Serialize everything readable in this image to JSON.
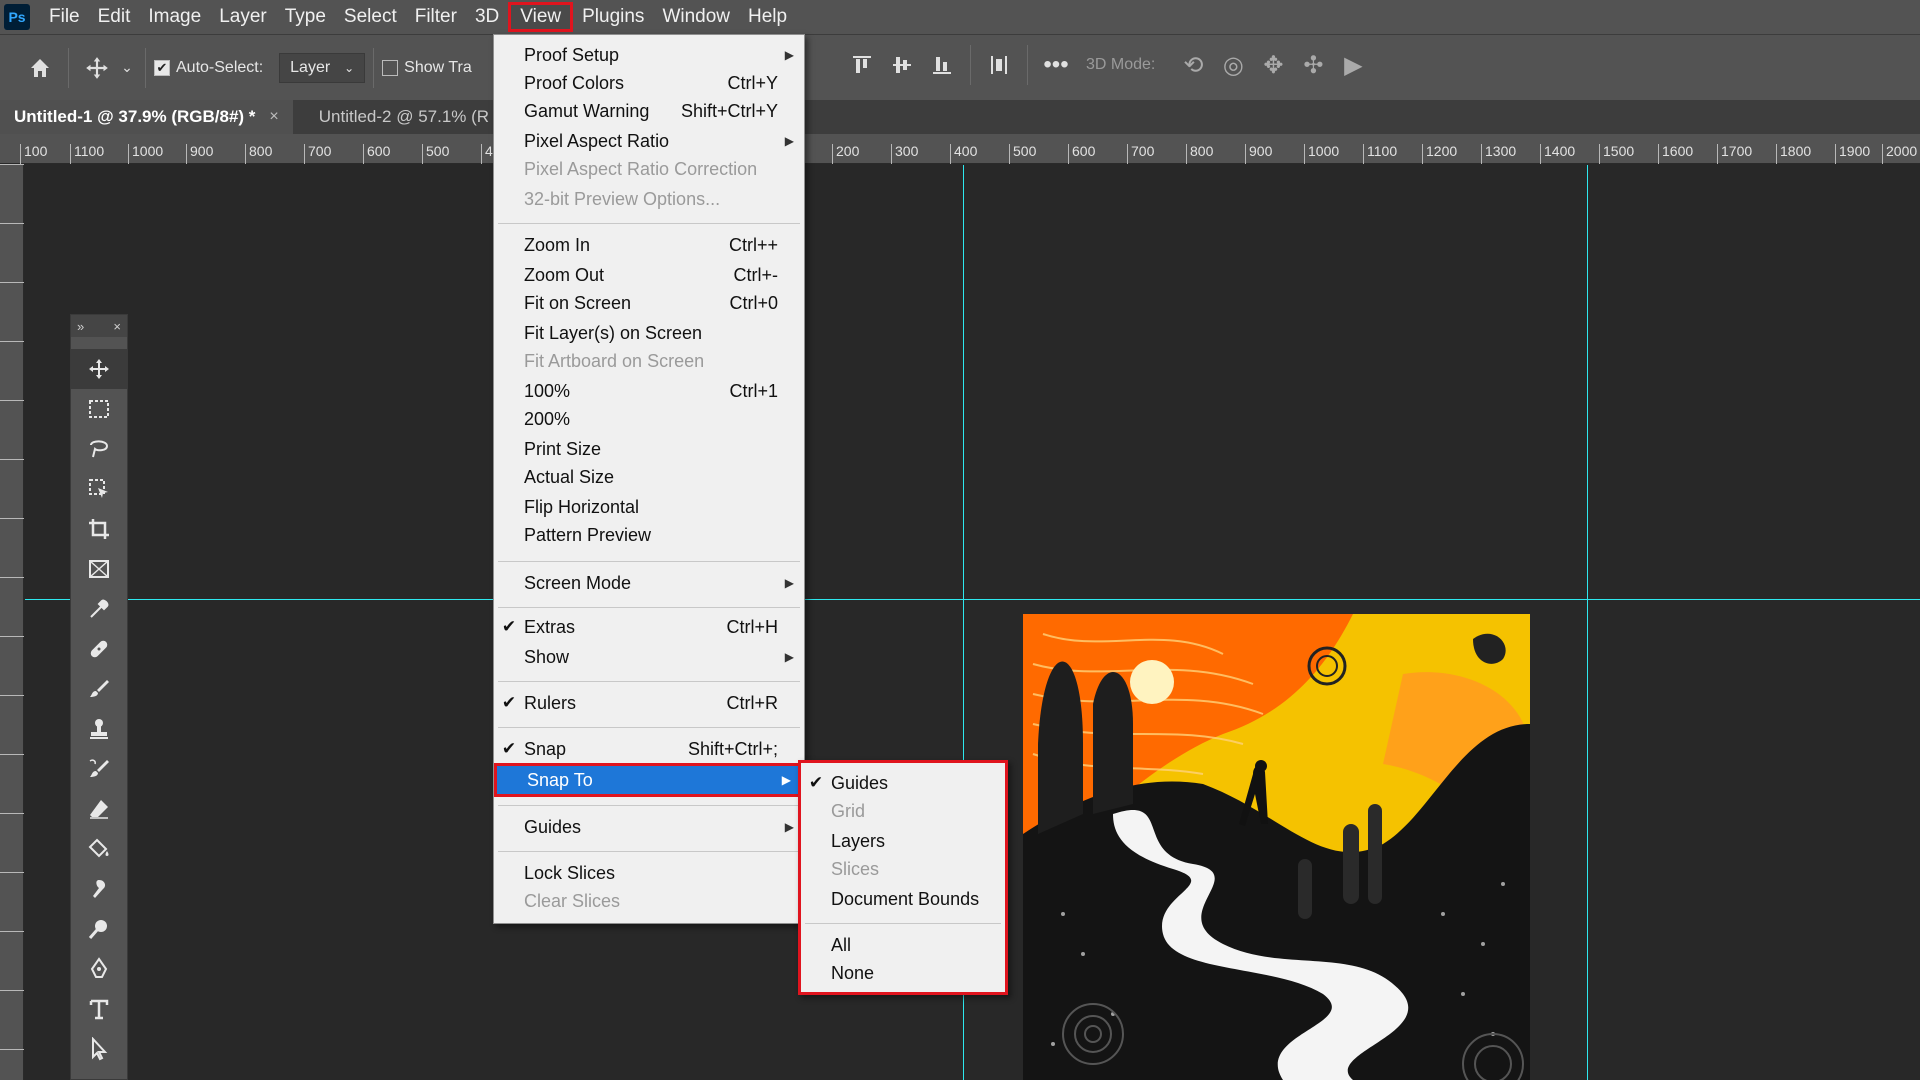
{
  "app": {
    "logo": "Ps",
    "menu": [
      "File",
      "Edit",
      "Image",
      "Layer",
      "Type",
      "Select",
      "Filter",
      "3D",
      "View",
      "Plugins",
      "Window",
      "Help"
    ],
    "active_menu": "View"
  },
  "options": {
    "auto_select_label": "Auto-Select:",
    "layer_select": "Layer",
    "show_transform_label": "Show Tra",
    "mode_3d_label": "3D Mode:"
  },
  "tabs": [
    {
      "label": "Untitled-1 @ 37.9% (RGB/8#) *",
      "close": "×"
    },
    {
      "label": "Untitled-2 @ 57.1% (R"
    }
  ],
  "ruler_labels": [
    "100",
    "1100",
    "1000",
    "900",
    "800",
    "700",
    "600",
    "500",
    "4",
    "200",
    "300",
    "400",
    "500",
    "600",
    "700",
    "800",
    "900",
    "1000",
    "1100",
    "1200",
    "1300",
    "1400",
    "1500",
    "1600",
    "1700",
    "1800",
    "1900",
    "2000"
  ],
  "toolbox": {
    "expand": "»",
    "close": "×"
  },
  "view_menu": {
    "items": [
      {
        "label": "Proof Setup",
        "submenu": true
      },
      {
        "label": "Proof Colors",
        "shortcut": "Ctrl+Y"
      },
      {
        "label": "Gamut Warning",
        "shortcut": "Shift+Ctrl+Y"
      },
      {
        "label": "Pixel Aspect Ratio",
        "submenu": true
      },
      {
        "label": "Pixel Aspect Ratio Correction",
        "disabled": true
      },
      {
        "label": "32-bit Preview Options...",
        "disabled": true
      },
      {
        "label": "Zoom In",
        "shortcut": "Ctrl++"
      },
      {
        "label": "Zoom Out",
        "shortcut": "Ctrl+-"
      },
      {
        "label": "Fit on Screen",
        "shortcut": "Ctrl+0"
      },
      {
        "label": "Fit Layer(s) on Screen"
      },
      {
        "label": "Fit Artboard on Screen",
        "disabled": true
      },
      {
        "label": "100%",
        "shortcut": "Ctrl+1"
      },
      {
        "label": "200%"
      },
      {
        "label": "Print Size"
      },
      {
        "label": "Actual Size"
      },
      {
        "label": "Flip Horizontal"
      },
      {
        "label": "Pattern Preview"
      },
      {
        "label": "Screen Mode",
        "submenu": true
      },
      {
        "label": "Extras",
        "shortcut": "Ctrl+H",
        "checked": true
      },
      {
        "label": "Show",
        "submenu": true
      },
      {
        "label": "Rulers",
        "shortcut": "Ctrl+R",
        "checked": true
      },
      {
        "label": "Snap",
        "shortcut": "Shift+Ctrl+;",
        "checked": true
      },
      {
        "label": "Snap To",
        "submenu": true,
        "highlighted": true
      },
      {
        "label": "Guides",
        "submenu": true
      },
      {
        "label": "Lock Slices"
      },
      {
        "label": "Clear Slices",
        "disabled": true
      }
    ]
  },
  "snap_to_menu": {
    "items": [
      {
        "label": "Guides",
        "checked": true
      },
      {
        "label": "Grid",
        "disabled": true
      },
      {
        "label": "Layers"
      },
      {
        "label": "Slices",
        "disabled": true
      },
      {
        "label": "Document Bounds"
      },
      {
        "label": "All"
      },
      {
        "label": "None"
      }
    ]
  },
  "colors": {
    "accent_highlight": "#1e77d8",
    "annotation_red": "#e0141e",
    "guide_cyan": "#2ee8ee"
  }
}
